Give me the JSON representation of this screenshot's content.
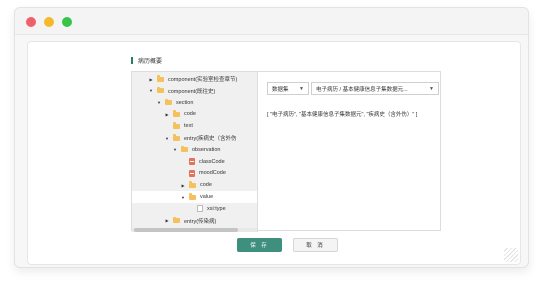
{
  "window": {
    "traffic_lights": [
      "close",
      "minimize",
      "maximize"
    ]
  },
  "panel": {
    "title": "病历概要"
  },
  "tree": {
    "rows": [
      {
        "label": "component(实验室检查章节)",
        "icon": "folder",
        "arrow": "collapsed",
        "level": 2
      },
      {
        "label": "component(既往史)",
        "icon": "folder",
        "arrow": "expanded",
        "level": 2
      },
      {
        "label": "section",
        "icon": "folder",
        "arrow": "expanded",
        "level": 3
      },
      {
        "label": "code",
        "icon": "folder",
        "arrow": "collapsed",
        "level": 4
      },
      {
        "label": "text",
        "icon": "folder",
        "arrow": "none",
        "level": 4
      },
      {
        "label": "entry(疾病史（含外伤",
        "icon": "folder",
        "arrow": "expanded",
        "level": 4
      },
      {
        "label": "observation",
        "icon": "folder",
        "arrow": "expanded",
        "level": 5
      },
      {
        "label": "classCode",
        "icon": "file",
        "arrow": "none",
        "level": 6
      },
      {
        "label": "moodCode",
        "icon": "file",
        "arrow": "none",
        "level": 6
      },
      {
        "label": "code",
        "icon": "folder",
        "arrow": "collapsed",
        "level": 6
      },
      {
        "label": "value",
        "icon": "folder",
        "arrow": "expanded",
        "level": 6,
        "selected": true
      },
      {
        "label": "xsi:type",
        "icon": "fileplain",
        "arrow": "none",
        "level": 7
      },
      {
        "label": "entry(传染病)",
        "icon": "folder",
        "arrow": "collapsed",
        "level": 4
      }
    ]
  },
  "selects": {
    "first": "数据集",
    "second": "电子病历 / 基本健康信息子集数据元..."
  },
  "result_text": "[ \"电子病历\", \"基本健康信息子集数据元\", \"疾病史（含外伤）\" ]",
  "buttons": {
    "save": "保 存",
    "cancel": "取 消"
  }
}
